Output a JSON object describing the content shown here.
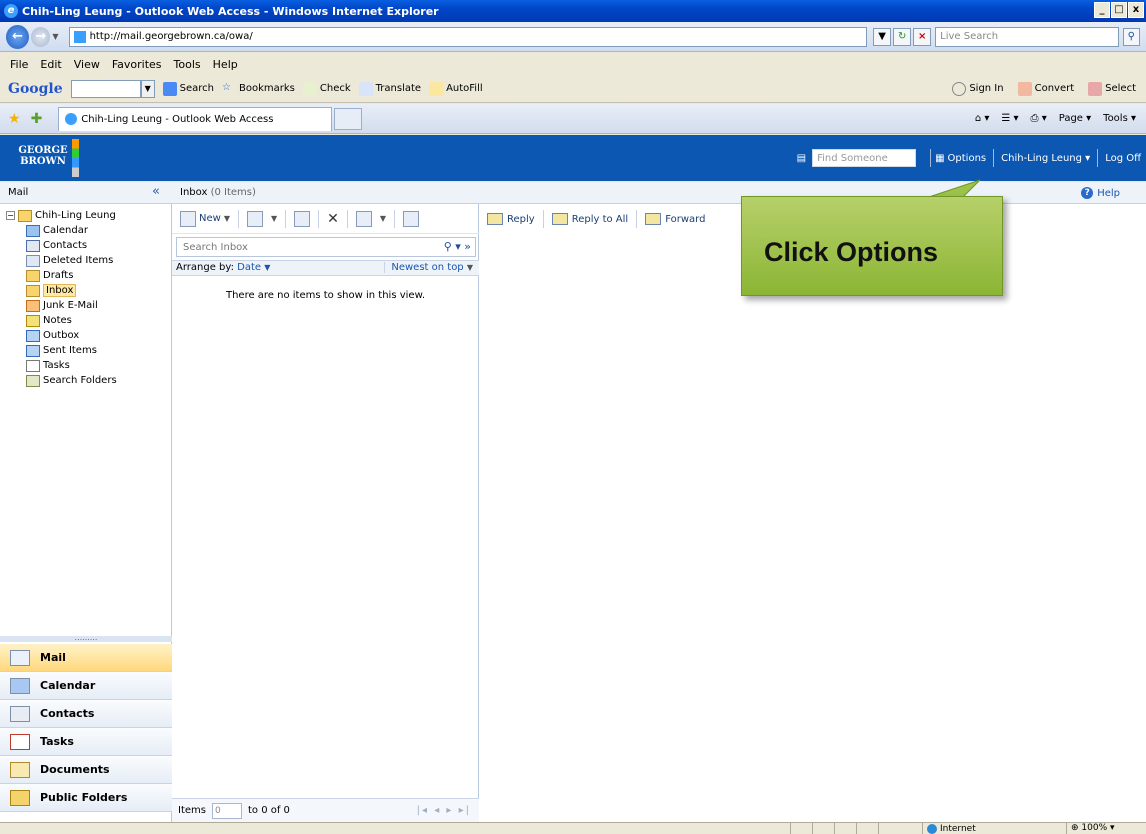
{
  "window": {
    "title": "Chih-Ling Leung - Outlook Web Access - Windows Internet Explorer",
    "controls": [
      "_",
      "□",
      "x"
    ]
  },
  "address": {
    "url": "http://mail.georgebrown.ca/owa/",
    "search_placeholder": "Live Search"
  },
  "menu": [
    "File",
    "Edit",
    "View",
    "Favorites",
    "Tools",
    "Help"
  ],
  "google_toolbar": {
    "logo": "Google",
    "search": "Search",
    "bookmarks": "Bookmarks",
    "check": "Check",
    "translate": "Translate",
    "autofill": "AutoFill",
    "sign_in": "Sign In",
    "convert": "Convert",
    "select": "Select"
  },
  "tabs": {
    "active_tab": "Chih-Ling Leung - Outlook Web Access",
    "commands": [
      "Page",
      "Tools"
    ]
  },
  "owa_header": {
    "logo_line1": "GEORGE",
    "logo_line2": "BROWN",
    "find_placeholder": "Find Someone",
    "options": "Options",
    "user": "Chih-Ling Leung",
    "log_off": "Log Off"
  },
  "subheader": {
    "mail": "Mail",
    "collapse": "«",
    "folder": "Inbox",
    "count": "(0 Items)",
    "help": "Help"
  },
  "tree": {
    "root": "Chih-Ling Leung",
    "folders": [
      "Calendar",
      "Contacts",
      "Deleted Items",
      "Drafts",
      "Inbox",
      "Junk E-Mail",
      "Notes",
      "Outbox",
      "Sent Items",
      "Tasks",
      "Search Folders"
    ]
  },
  "nav_buttons": [
    "Mail",
    "Calendar",
    "Contacts",
    "Tasks",
    "Documents",
    "Public Folders"
  ],
  "list": {
    "new": "New",
    "search_placeholder": "Search Inbox",
    "arrange_label": "Arrange by:",
    "arrange_value": "Date",
    "sort": "Newest on top",
    "empty": "There are no items to show in this view.",
    "items_label": "Items",
    "items_value": "0",
    "range": "to 0 of 0"
  },
  "reading": {
    "reply": "Reply",
    "reply_all": "Reply to All",
    "forward": "Forward"
  },
  "callout": {
    "text": "Click Options",
    "color": "#9cc24a"
  },
  "status": {
    "zone": "Internet",
    "zoom": "100%"
  }
}
